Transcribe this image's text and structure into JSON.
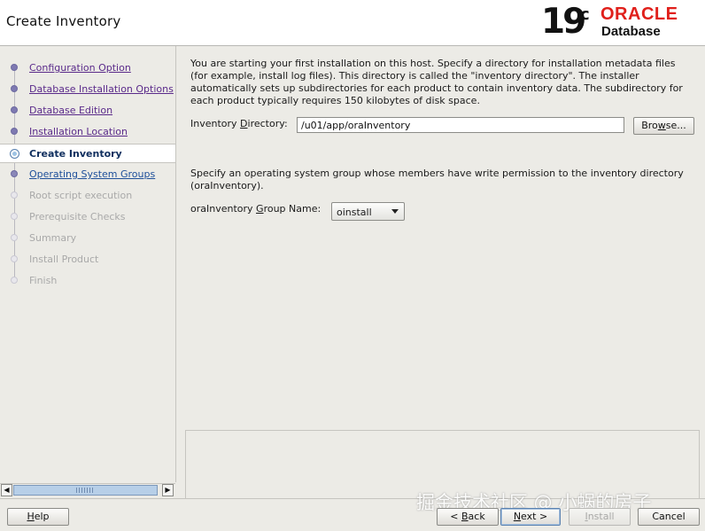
{
  "window": {
    "title": "Create Inventory"
  },
  "logo": {
    "version": "19",
    "version_sup": "c",
    "brand": "ORACLE",
    "product": "Database"
  },
  "steps": [
    {
      "label": "Configuration Option",
      "state": "done"
    },
    {
      "label": "Database Installation Options",
      "state": "done"
    },
    {
      "label": "Database Edition",
      "state": "done"
    },
    {
      "label": "Installation Location",
      "state": "done"
    },
    {
      "label": "Create Inventory",
      "state": "current"
    },
    {
      "label": "Operating System Groups",
      "state": "next"
    },
    {
      "label": "Root script execution",
      "state": "todo"
    },
    {
      "label": "Prerequisite Checks",
      "state": "todo"
    },
    {
      "label": "Summary",
      "state": "todo"
    },
    {
      "label": "Install Product",
      "state": "todo"
    },
    {
      "label": "Finish",
      "state": "todo"
    }
  ],
  "main": {
    "description": "You are starting your first installation on this host. Specify a directory for installation metadata files (for example, install log files). This directory is called the \"inventory directory\". The installer automatically sets up subdirectories for each product to contain inventory data. The subdirectory for each product typically requires 150 kilobytes of disk space.",
    "inventory_label": {
      "pre": "Inventory ",
      "key": "D",
      "post": "irectory:"
    },
    "inventory_value": "/u01/app/oraInventory",
    "browse": {
      "key": "w",
      "pre": "Bro",
      "post": "se..."
    },
    "group_description": "Specify an operating system group whose members have write permission to the inventory directory (oraInventory).",
    "group_label": {
      "pre": "oraInventory ",
      "key": "G",
      "post": "roup Name:"
    },
    "group_value": "oinstall"
  },
  "buttons": {
    "help": {
      "key": "H",
      "post": "elp"
    },
    "back": {
      "pre": "< ",
      "key": "B",
      "post": "ack"
    },
    "next": {
      "key": "N",
      "post": "ext >"
    },
    "install": {
      "key": "I",
      "post": "nstall"
    },
    "cancel": "Cancel"
  },
  "watermark": "掘金技术社区 @ 小蜗的房子",
  "colors": {
    "brand_red": "#e0201b",
    "current_step": "#0f2e5e",
    "link": "#5a2a8a"
  }
}
